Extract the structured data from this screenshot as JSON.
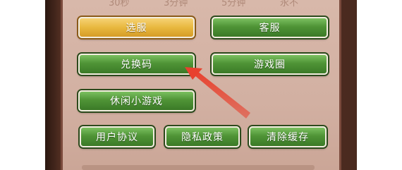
{
  "time_options": [
    "30秒",
    "3分钟",
    "5分钟",
    "永不"
  ],
  "buttons": {
    "server_select": "选服",
    "customer_service": "客服",
    "redeem_code": "兑换码",
    "game_circle": "游戏圈",
    "casual_games": "休闲小游戏",
    "user_agreement": "用户协议",
    "privacy_policy": "隐私政策",
    "clear_cache": "清除缓存"
  },
  "colors": {
    "green_button": "#4f9436",
    "gold_button": "#e8b83f",
    "annotation_arrow": "#e8412e"
  }
}
